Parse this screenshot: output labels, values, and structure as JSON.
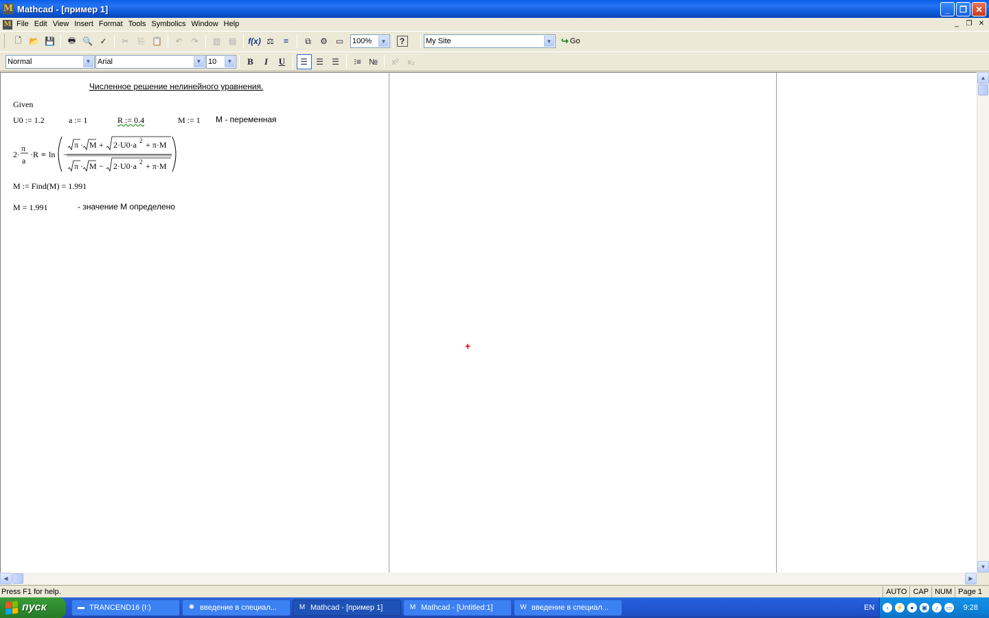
{
  "window": {
    "title": "Mathcad - [пример 1]"
  },
  "menu": [
    "File",
    "Edit",
    "View",
    "Insert",
    "Format",
    "Tools",
    "Symbolics",
    "Window",
    "Help"
  ],
  "toolbar": {
    "zoom": "100%",
    "site": "My Site",
    "go_label": "Go",
    "style": "Normal",
    "font": "Arial",
    "size": "10",
    "bold": "B",
    "italic": "I",
    "underline": "U"
  },
  "worksheet": {
    "heading": "Численное решение нелинейного уравнения.",
    "given": "Given",
    "defs": [
      "U0 := 1.2",
      "a := 1",
      "R := 0.4",
      "M := 1"
    ],
    "defs_note": "M - переменная",
    "find_expr": "M := Find(M) = 1.991",
    "result": "M = 1.991",
    "result_note": "- значение М определено"
  },
  "status": {
    "help": "Press F1 for help.",
    "indicators": [
      "AUTO",
      "CAP",
      "NUM",
      "Page 1"
    ]
  },
  "taskbar": {
    "start_label": "пуск",
    "tasks": [
      "TRANCEND16 (I:)",
      "введение в специал...",
      "Mathcad - [пример 1]",
      "Mathcad - [Untitled:1]",
      "введение в специал..."
    ],
    "lang": "EN",
    "clock": "9:28"
  },
  "colors": {
    "title_bar": "#0a5ee8",
    "taskbar": "#245edb",
    "start": "#2f8f2f",
    "crosshair": "#e00000"
  }
}
